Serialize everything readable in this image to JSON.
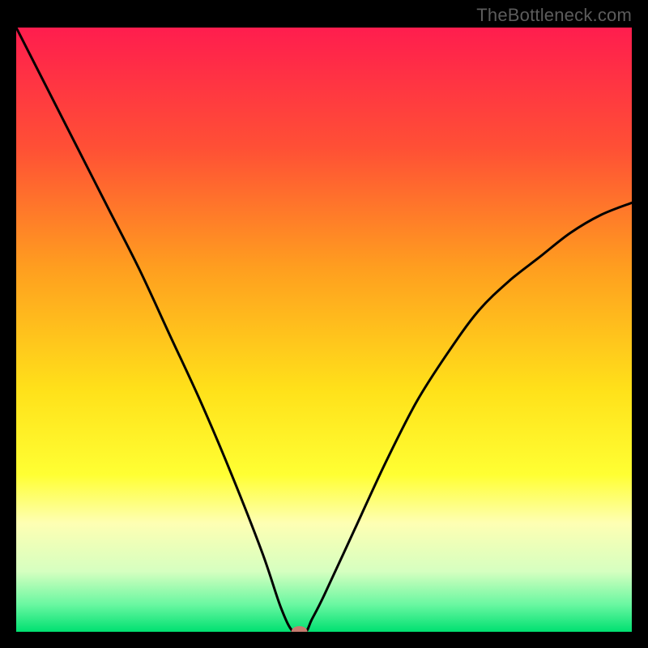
{
  "watermark": "TheBottleneck.com",
  "chart_data": {
    "type": "line",
    "title": "",
    "xlabel": "",
    "ylabel": "",
    "xlim": [
      0,
      100
    ],
    "ylim": [
      0,
      100
    ],
    "series": [
      {
        "name": "bottleneck-curve",
        "x": [
          0,
          5,
          10,
          15,
          20,
          25,
          30,
          35,
          40,
          43,
          45,
          47,
          48,
          50,
          55,
          60,
          65,
          70,
          75,
          80,
          85,
          90,
          95,
          100
        ],
        "y": [
          100,
          90,
          80,
          70,
          60,
          49,
          38,
          26,
          13,
          4,
          0,
          0,
          2,
          6,
          17,
          28,
          38,
          46,
          53,
          58,
          62,
          66,
          69,
          71
        ]
      }
    ],
    "marker": {
      "x": 46,
      "y": 0,
      "color": "#c77b6f"
    },
    "background_gradient": {
      "stops": [
        {
          "offset": 0.0,
          "color": "#ff1d4e"
        },
        {
          "offset": 0.2,
          "color": "#ff5035"
        },
        {
          "offset": 0.4,
          "color": "#ff9f1f"
        },
        {
          "offset": 0.6,
          "color": "#ffe11a"
        },
        {
          "offset": 0.74,
          "color": "#ffff33"
        },
        {
          "offset": 0.82,
          "color": "#feffb3"
        },
        {
          "offset": 0.9,
          "color": "#d6ffc0"
        },
        {
          "offset": 0.955,
          "color": "#69f7a1"
        },
        {
          "offset": 1.0,
          "color": "#00e071"
        }
      ]
    }
  }
}
